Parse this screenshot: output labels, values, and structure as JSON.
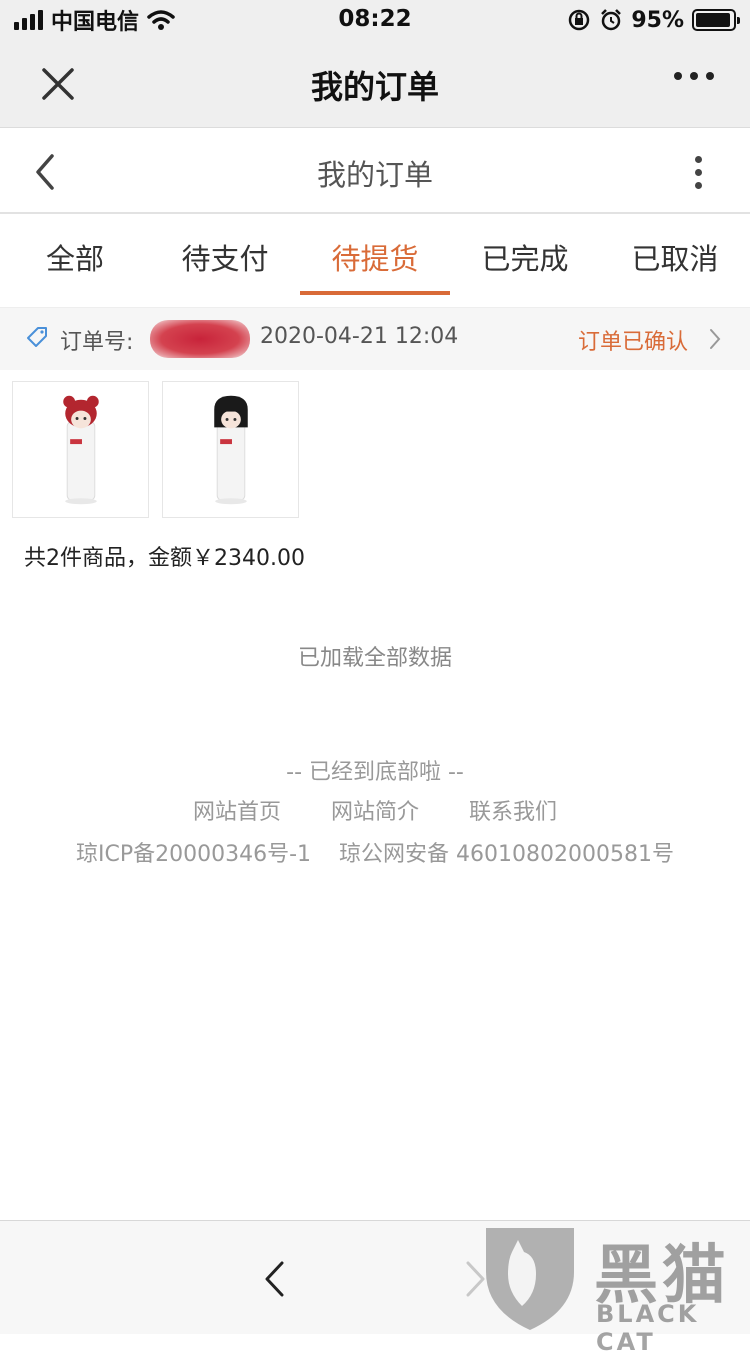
{
  "status_bar": {
    "carrier": "中国电信",
    "time": "08:22",
    "battery_percent": "95%",
    "battery_level": 0.95
  },
  "wechat_bar": {
    "title": "我的订单",
    "close_icon": "close-icon",
    "more_icon": "more-horizontal-icon"
  },
  "page_header": {
    "title": "我的订单",
    "back_icon": "chevron-left-icon",
    "menu_icon": "more-vertical-icon"
  },
  "tabs": [
    {
      "label": "全部",
      "active": false
    },
    {
      "label": "待支付",
      "active": false
    },
    {
      "label": "待提货",
      "active": true
    },
    {
      "label": "已完成",
      "active": false
    },
    {
      "label": "已取消",
      "active": false
    }
  ],
  "order": {
    "number_label": "订单号:",
    "date": "2020-04-21 12:04",
    "status": "订单已确认",
    "summary": "共2件商品，金额￥2340.00",
    "items": [
      {
        "name": "product-bottle-red-hair"
      },
      {
        "name": "product-bottle-black-hair"
      }
    ]
  },
  "footer": {
    "loaded_text": "已加载全部数据",
    "bottom_text": "-- 已经到底部啦 --",
    "links": [
      "网站首页",
      "网站简介",
      "联系我们"
    ],
    "icp": "琼ICP备20000346号-1",
    "police": "琼公网安备 46010802000581号"
  },
  "watermark": {
    "cn": "黑猫",
    "en": "BLACK CAT"
  },
  "colors": {
    "accent": "#d96b38",
    "bar_bg": "#efefef"
  }
}
